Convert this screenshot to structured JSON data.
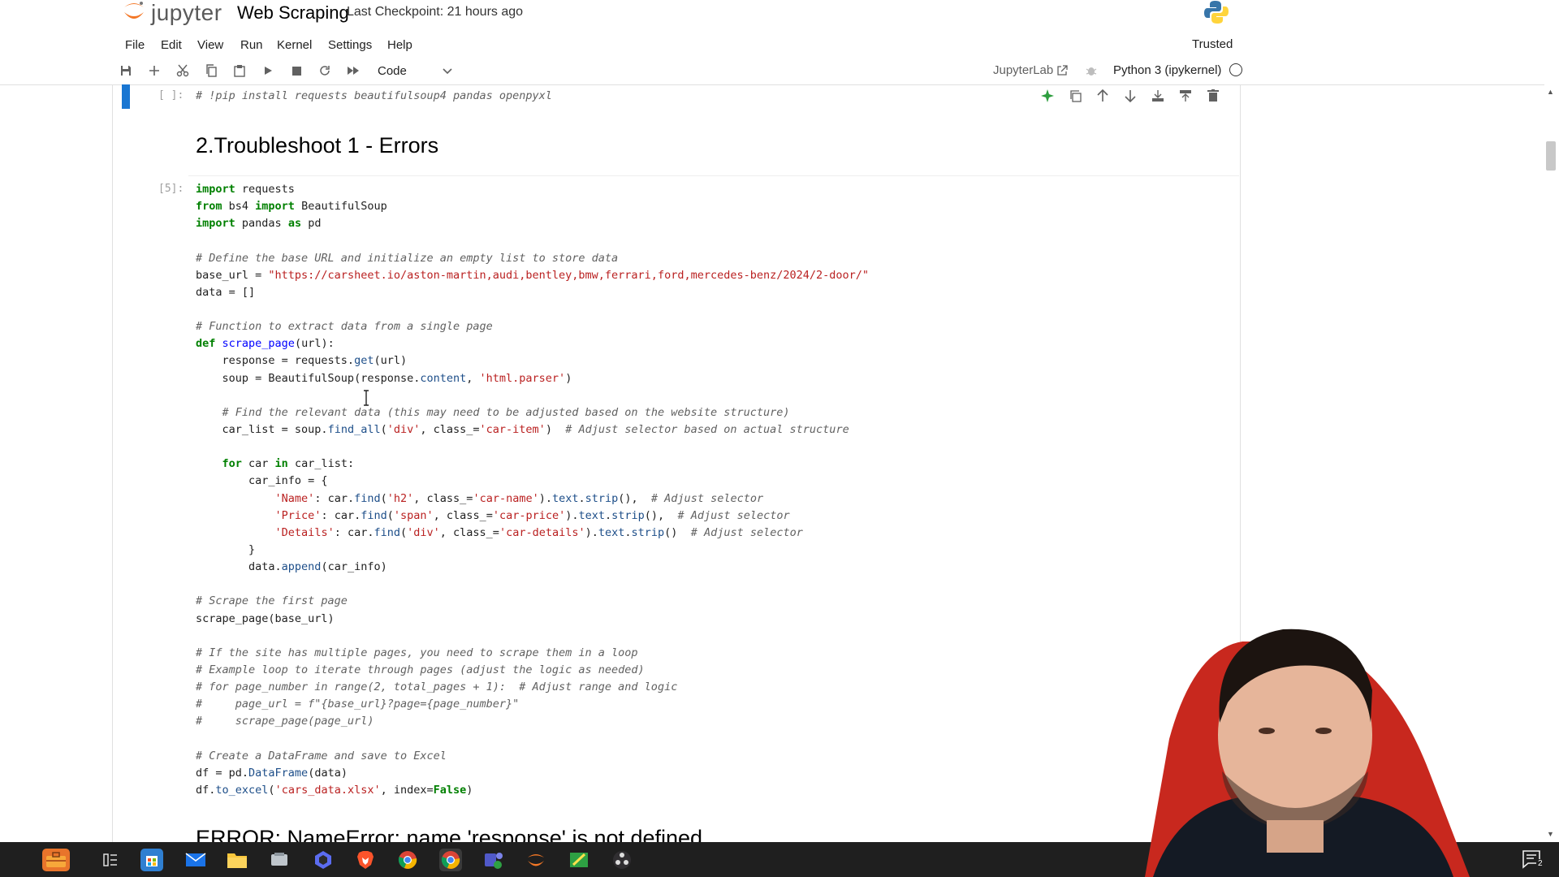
{
  "header": {
    "logo_text": "jupyter",
    "notebook_title": "Web Scraping",
    "checkpoint": "Last Checkpoint: 21 hours ago"
  },
  "menu": {
    "items": [
      "File",
      "Edit",
      "View",
      "Run",
      "Kernel",
      "Settings",
      "Help"
    ],
    "trusted": "Trusted"
  },
  "toolbar": {
    "cell_type": "Code",
    "jupyterlab_link": "JupyterLab",
    "kernel_name": "Python 3 (ipykernel)"
  },
  "cells": {
    "cell1_prompt": "[ ]:",
    "cell1_code": "# !pip install requests beautifulsoup4 pandas openpyxl",
    "markdown_heading": "2.Troubleshoot 1 - Errors",
    "cell2_prompt": "[5]:",
    "error_heading": "ERROR: NameError: name 'response' is not defined"
  },
  "code_lines": [
    [
      [
        "kw",
        "import"
      ],
      [
        "nm",
        " requests"
      ]
    ],
    [
      [
        "kw",
        "from"
      ],
      [
        "nm",
        " bs4 "
      ],
      [
        "kw",
        "import"
      ],
      [
        "nm",
        " BeautifulSoup"
      ]
    ],
    [
      [
        "kw",
        "import"
      ],
      [
        "nm",
        " pandas "
      ],
      [
        "kw",
        "as"
      ],
      [
        "nm",
        " pd"
      ]
    ],
    [],
    [
      [
        "cm",
        "# Define the base URL and initialize an empty list to store data"
      ]
    ],
    [
      [
        "nm",
        "base_url = "
      ],
      [
        "st",
        "\"https://carsheet.io/aston-martin,audi,bentley,bmw,ferrari,ford,mercedes-benz/2024/2-door/\""
      ]
    ],
    [
      [
        "nm",
        "data = []"
      ]
    ],
    [],
    [
      [
        "cm",
        "# Function to extract data from a single page"
      ]
    ],
    [
      [
        "kw",
        "def"
      ],
      [
        "nm",
        " "
      ],
      [
        "fn",
        "scrape_page"
      ],
      [
        "nm",
        "(url):"
      ]
    ],
    [
      [
        "nm",
        "    response = requests."
      ],
      [
        "at",
        "get"
      ],
      [
        "nm",
        "(url)"
      ]
    ],
    [
      [
        "nm",
        "    soup = BeautifulSoup(response."
      ],
      [
        "at",
        "content"
      ],
      [
        "nm",
        ", "
      ],
      [
        "st",
        "'html.parser'"
      ],
      [
        "nm",
        ")"
      ]
    ],
    [],
    [
      [
        "nm",
        "    "
      ],
      [
        "cm",
        "# Find the relevant data (this may need to be adjusted based on the website structure)"
      ]
    ],
    [
      [
        "nm",
        "    car_list = soup."
      ],
      [
        "at",
        "find_all"
      ],
      [
        "nm",
        "("
      ],
      [
        "st",
        "'div'"
      ],
      [
        "nm",
        ", class_="
      ],
      [
        "st",
        "'car-item'"
      ],
      [
        "nm",
        ")  "
      ],
      [
        "cm",
        "# Adjust selector based on actual structure"
      ]
    ],
    [],
    [
      [
        "nm",
        "    "
      ],
      [
        "kw",
        "for"
      ],
      [
        "nm",
        " car "
      ],
      [
        "kw",
        "in"
      ],
      [
        "nm",
        " car_list:"
      ]
    ],
    [
      [
        "nm",
        "        car_info = {"
      ]
    ],
    [
      [
        "nm",
        "            "
      ],
      [
        "st",
        "'Name'"
      ],
      [
        "nm",
        ": car."
      ],
      [
        "at",
        "find"
      ],
      [
        "nm",
        "("
      ],
      [
        "st",
        "'h2'"
      ],
      [
        "nm",
        ", class_="
      ],
      [
        "st",
        "'car-name'"
      ],
      [
        "nm",
        ")."
      ],
      [
        "at",
        "text"
      ],
      [
        "nm",
        "."
      ],
      [
        "at",
        "strip"
      ],
      [
        "nm",
        "(),  "
      ],
      [
        "cm",
        "# Adjust selector"
      ]
    ],
    [
      [
        "nm",
        "            "
      ],
      [
        "st",
        "'Price'"
      ],
      [
        "nm",
        ": car."
      ],
      [
        "at",
        "find"
      ],
      [
        "nm",
        "("
      ],
      [
        "st",
        "'span'"
      ],
      [
        "nm",
        ", class_="
      ],
      [
        "st",
        "'car-price'"
      ],
      [
        "nm",
        ")."
      ],
      [
        "at",
        "text"
      ],
      [
        "nm",
        "."
      ],
      [
        "at",
        "strip"
      ],
      [
        "nm",
        "(),  "
      ],
      [
        "cm",
        "# Adjust selector"
      ]
    ],
    [
      [
        "nm",
        "            "
      ],
      [
        "st",
        "'Details'"
      ],
      [
        "nm",
        ": car."
      ],
      [
        "at",
        "find"
      ],
      [
        "nm",
        "("
      ],
      [
        "st",
        "'div'"
      ],
      [
        "nm",
        ", class_="
      ],
      [
        "st",
        "'car-details'"
      ],
      [
        "nm",
        ")."
      ],
      [
        "at",
        "text"
      ],
      [
        "nm",
        "."
      ],
      [
        "at",
        "strip"
      ],
      [
        "nm",
        "()  "
      ],
      [
        "cm",
        "# Adjust selector"
      ]
    ],
    [
      [
        "nm",
        "        }"
      ]
    ],
    [
      [
        "nm",
        "        data."
      ],
      [
        "at",
        "append"
      ],
      [
        "nm",
        "(car_info)"
      ]
    ],
    [],
    [
      [
        "cm",
        "# Scrape the first page"
      ]
    ],
    [
      [
        "nm",
        "scrape_page(base_url)"
      ]
    ],
    [],
    [
      [
        "cm",
        "# If the site has multiple pages, you need to scrape them in a loop"
      ]
    ],
    [
      [
        "cm",
        "# Example loop to iterate through pages (adjust the logic as needed)"
      ]
    ],
    [
      [
        "cm",
        "# for page_number in range(2, total_pages + 1):  # Adjust range and logic"
      ]
    ],
    [
      [
        "cm",
        "#     page_url = f\"{base_url}?page={page_number}\""
      ]
    ],
    [
      [
        "cm",
        "#     scrape_page(page_url)"
      ]
    ],
    [],
    [
      [
        "cm",
        "# Create a DataFrame and save to Excel"
      ]
    ],
    [
      [
        "nm",
        "df = pd."
      ],
      [
        "at",
        "DataFrame"
      ],
      [
        "nm",
        "(data)"
      ]
    ],
    [
      [
        "nm",
        "df."
      ],
      [
        "at",
        "to_excel"
      ],
      [
        "nm",
        "("
      ],
      [
        "st",
        "'cars_data.xlsx'"
      ],
      [
        "nm",
        ", index="
      ],
      [
        "kw",
        "False"
      ],
      [
        "nm",
        ")"
      ]
    ]
  ],
  "taskbar": {
    "notification_count": "2"
  },
  "colors": {
    "accent": "#1976d2",
    "taskbar": "#1f1f1f",
    "keyword": "#008000",
    "string": "#ba2121"
  }
}
